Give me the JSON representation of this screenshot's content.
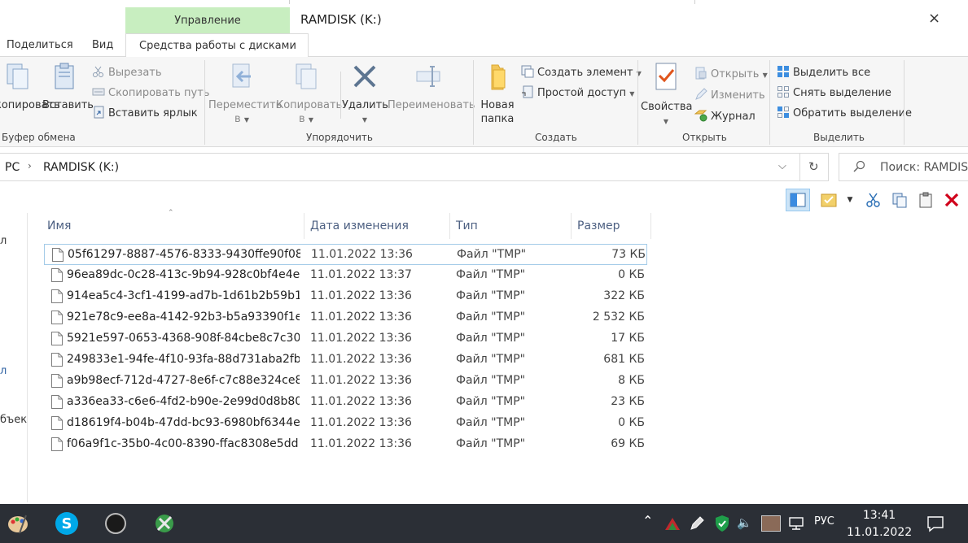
{
  "window": {
    "title": "RAMDISK (K:)",
    "close_glyph": "×",
    "context_tab": "Управление",
    "tabs": {
      "share": "Поделиться",
      "view": "Вид",
      "drive_tools": "Средства работы с дисками"
    }
  },
  "ribbon": {
    "clipboard": {
      "label": "Буфер обмена",
      "copy": "копировать",
      "paste": "Вставить",
      "cut": "Вырезать",
      "copy_path": "Скопировать путь",
      "paste_shortcut": "Вставить ярлык"
    },
    "organize": {
      "label": "Упорядочить",
      "move_to": "Переместить",
      "copy_to": "Копировать",
      "to": "в",
      "delete": "Удалить",
      "rename": "Переименовать"
    },
    "create": {
      "label": "Создать",
      "new_folder_1": "Новая",
      "new_folder_2": "папка",
      "new_item": "Создать элемент",
      "easy_access": "Простой доступ"
    },
    "open": {
      "label": "Открыть",
      "properties": "Свойства",
      "open": "Открыть",
      "edit": "Изменить",
      "history": "Журнал"
    },
    "select": {
      "label": "Выделить",
      "select_all": "Выделить все",
      "select_none": "Снять выделение",
      "invert": "Обратить выделение"
    }
  },
  "address": {
    "crumb_1": "PC",
    "crumb_sep": "›",
    "crumb_2": "RAMDISK (K:)",
    "search_placeholder": "Поиск: RAMDISK (K:)"
  },
  "left_nav": {
    "item_1": "л",
    "item_2": "л",
    "item_3": "бъект"
  },
  "columns": {
    "name": "Имя",
    "date": "Дата изменения",
    "type": "Тип",
    "size": "Размер"
  },
  "files": [
    {
      "name": "05f61297-8887-4576-8333-9430ffe90f08....",
      "date": "11.01.2022 13:36",
      "type": "Файл \"TMP\"",
      "size": "73 КБ"
    },
    {
      "name": "96ea89dc-0c28-413c-9b94-928c0bf4e4e...",
      "date": "11.01.2022 13:37",
      "type": "Файл \"TMP\"",
      "size": "0 КБ"
    },
    {
      "name": "914ea5c4-3cf1-4199-ad7b-1d61b2b59b1...",
      "date": "11.01.2022 13:36",
      "type": "Файл \"TMP\"",
      "size": "322 КБ"
    },
    {
      "name": "921e78c9-ee8a-4142-92b3-b5a93390f1e...",
      "date": "11.01.2022 13:36",
      "type": "Файл \"TMP\"",
      "size": "2 532 КБ"
    },
    {
      "name": "5921e597-0653-4368-908f-84cbe8c7c30...",
      "date": "11.01.2022 13:36",
      "type": "Файл \"TMP\"",
      "size": "17 КБ"
    },
    {
      "name": "249833e1-94fe-4f10-93fa-88d731aba2fb...",
      "date": "11.01.2022 13:36",
      "type": "Файл \"TMP\"",
      "size": "681 КБ"
    },
    {
      "name": "a9b98ecf-712d-4727-8e6f-c7c88e324ce8...",
      "date": "11.01.2022 13:36",
      "type": "Файл \"TMP\"",
      "size": "8 КБ"
    },
    {
      "name": "a336ea33-c6e6-4fd2-b90e-2e99d0d8b80...",
      "date": "11.01.2022 13:36",
      "type": "Файл \"TMP\"",
      "size": "23 КБ"
    },
    {
      "name": "d18619f4-b04b-47dd-bc93-6980bf6344e...",
      "date": "11.01.2022 13:36",
      "type": "Файл \"TMP\"",
      "size": "0 КБ"
    },
    {
      "name": "f06a9f1c-35b0-4c00-8390-ffac8308e5dd....",
      "date": "11.01.2022 13:36",
      "type": "Файл \"TMP\"",
      "size": "69 КБ"
    }
  ],
  "taskbar": {
    "lang": "РУС",
    "time": "13:41",
    "date": "11.01.2022",
    "skype_letter": "S"
  },
  "colors": {
    "accent": "#0078d7",
    "context_band": "#c8eec0",
    "taskbar": "#2b2f36",
    "delete_red": "#d0021b"
  }
}
